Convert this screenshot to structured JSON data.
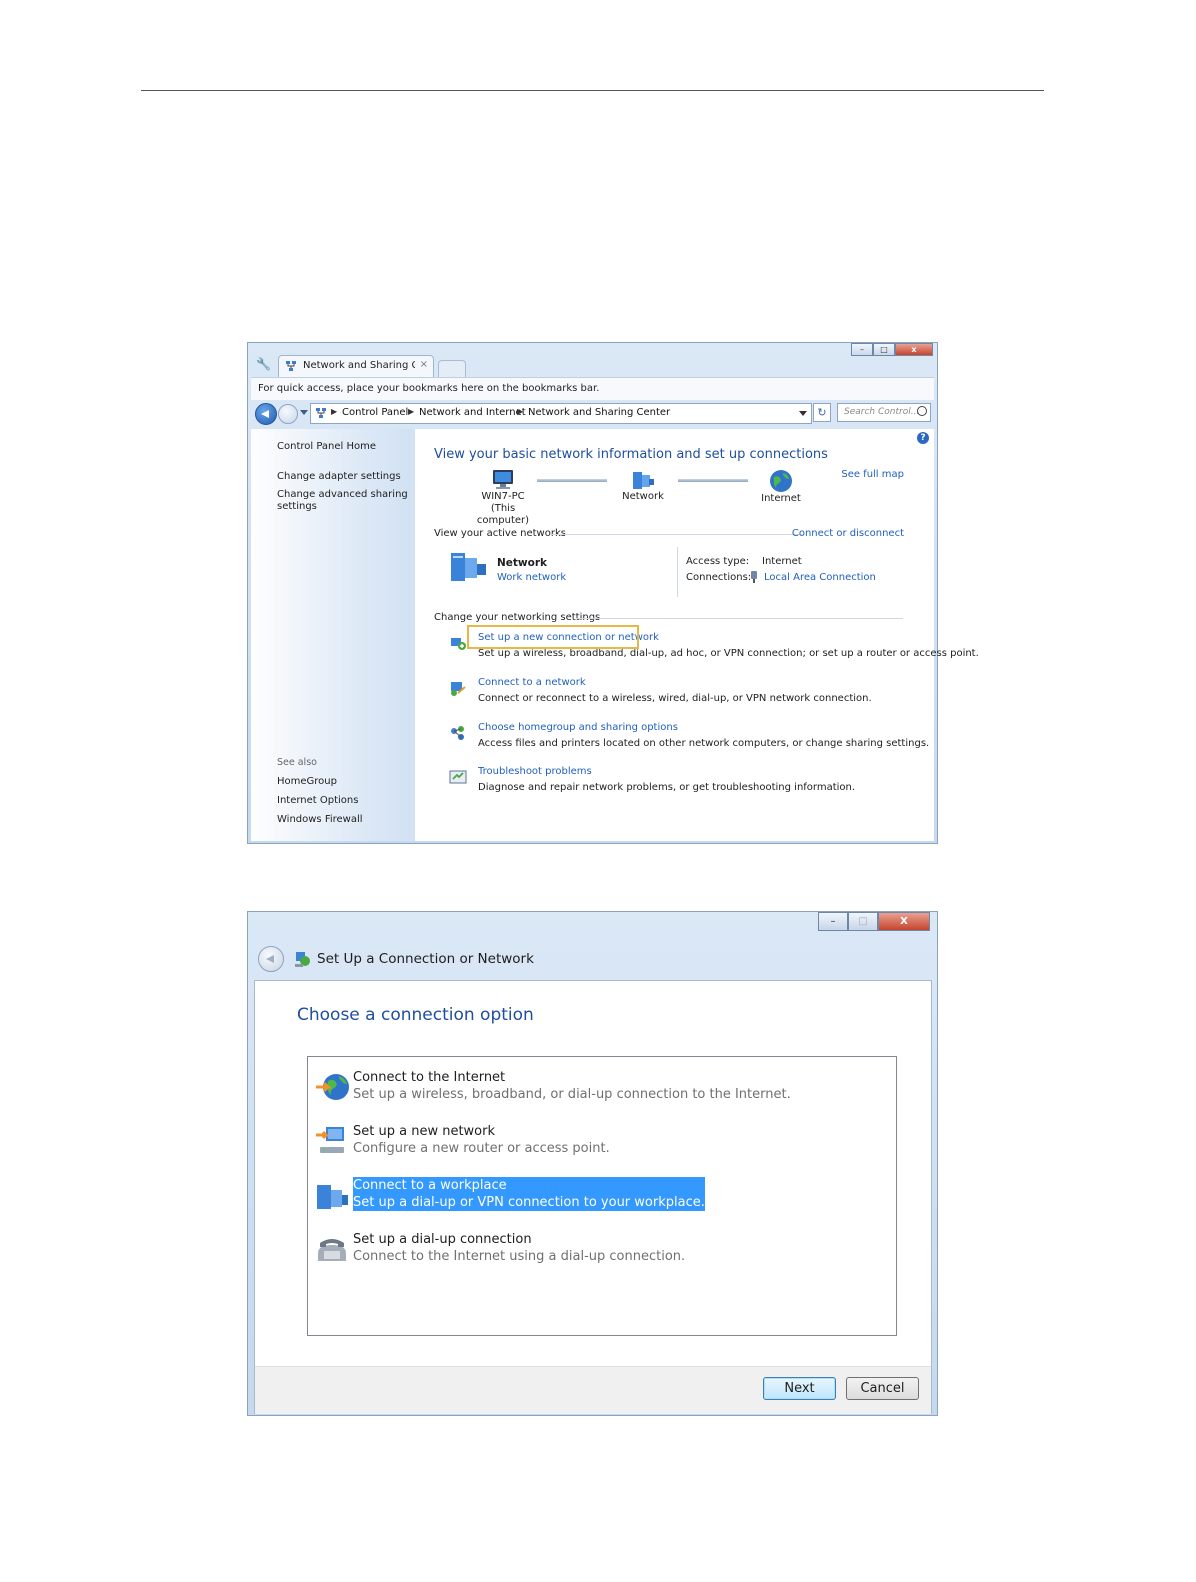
{
  "browser": {
    "tab_title": "Network and Sharing Cent",
    "bookmarks_hint": "For quick access, place your bookmarks here on the bookmarks bar.",
    "breadcrumb": [
      "Control Panel",
      "Network and Internet",
      "Network and Sharing Center"
    ],
    "search_placeholder": "Search Control...",
    "sidebar": {
      "home": "Control Panel Home",
      "links": [
        "Change adapter settings",
        "Change advanced sharing",
        "settings"
      ],
      "see_also_label": "See also",
      "see_also": [
        "HomeGroup",
        "Internet Options",
        "Windows Firewall"
      ]
    },
    "main": {
      "title": "View your basic network information and set up connections",
      "see_full_map": "See full map",
      "nodes": [
        {
          "name": "WIN7-PC",
          "sub": "(This computer)"
        },
        {
          "name": "Network",
          "sub": ""
        },
        {
          "name": "Internet",
          "sub": ""
        }
      ],
      "active_networks_label": "View your active networks",
      "connect_disconnect": "Connect or disconnect",
      "network_name": "Network",
      "network_type": "Work network",
      "access_type_label": "Access type:",
      "access_type_value": "Internet",
      "connections_label": "Connections:",
      "connections_value": "Local Area Connection",
      "change_settings_label": "Change your networking settings",
      "tasks": [
        {
          "link": "Set up a new connection or network",
          "desc": "Set up a wireless, broadband, dial-up, ad hoc, or VPN connection; or set up a router or access point."
        },
        {
          "link": "Connect to a network",
          "desc": "Connect or reconnect to a wireless, wired, dial-up, or VPN network connection."
        },
        {
          "link": "Choose homegroup and sharing options",
          "desc": "Access files and printers located on other network computers, or change sharing settings."
        },
        {
          "link": "Troubleshoot problems",
          "desc": "Diagnose and repair network problems, or get troubleshooting information."
        }
      ]
    }
  },
  "wizard": {
    "window_title": "Set Up a Connection or Network",
    "heading": "Choose a connection option",
    "options": [
      {
        "title": "Connect to the Internet",
        "desc": "Set up a wireless, broadband, or dial-up connection to the Internet.",
        "selected": false
      },
      {
        "title": "Set up a new network",
        "desc": "Configure a new router or access point.",
        "selected": false
      },
      {
        "title": "Connect to a workplace",
        "desc": "Set up a dial-up or VPN connection to your workplace.",
        "selected": true
      },
      {
        "title": "Set up a dial-up connection",
        "desc": "Connect to the Internet using a dial-up connection.",
        "selected": false
      }
    ],
    "next_label": "Next",
    "cancel_label": "Cancel"
  },
  "colors": {
    "link": "#1f5fbf",
    "heading": "#1e4e9c",
    "selection": "#3399ff",
    "highlight_box": "#e6b84a"
  }
}
